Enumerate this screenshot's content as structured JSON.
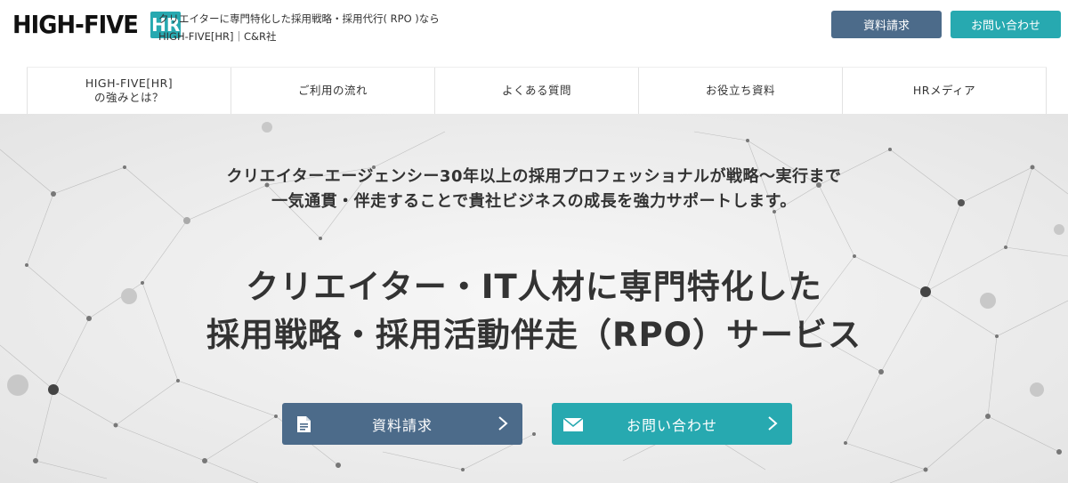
{
  "header": {
    "logo_text": "HIGH-FIVE",
    "logo_badge": "HR",
    "tagline_line1": "クリエイターに専門特化した採用戦略・採用代行( RPO )なら",
    "tagline_line2": "HIGH-FIVE[HR]｜C&R社",
    "doc_button": "資料請求",
    "contact_button": "お問い合わせ"
  },
  "nav": {
    "items": [
      "HIGH-FIVE[HR]\nの強みとは？",
      "ご利用の流れ",
      "よくある質問",
      "お役立ち資料",
      "HRメディア"
    ]
  },
  "hero": {
    "lead_line1": "クリエイターエージェンシー30年以上の採用プロフェッショナルが戦略〜実行まで",
    "lead_line2": "一気通貫・伴走することで貴社ビジネスの成長を強力サポートします。",
    "headline_line1": "クリエイター・IT人材に専門特化した",
    "headline_line2": "採用戦略・採用活動伴走（RPO）サービス",
    "cta_doc": "資料請求",
    "cta_contact": "お問い合わせ"
  },
  "colors": {
    "navy": "#4c6b8a",
    "teal": "#27a9b0"
  },
  "icons": {
    "cta_doc_icon": "document-icon",
    "cta_contact_icon": "envelope-icon",
    "arrow_icon": "chevron-right-icon"
  }
}
